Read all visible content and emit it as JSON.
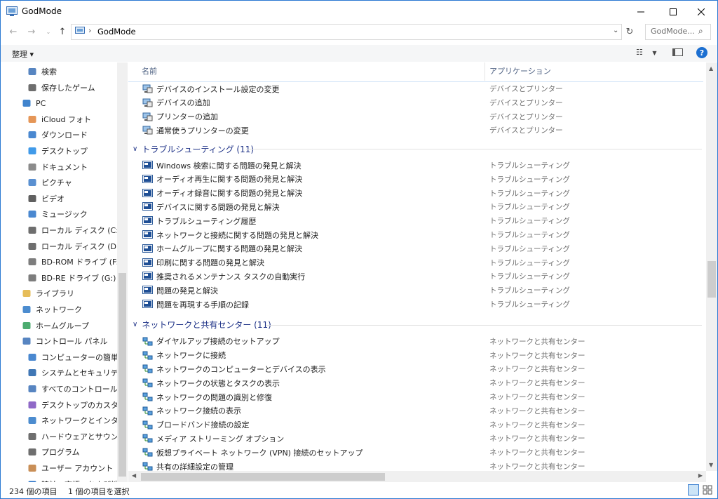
{
  "window": {
    "title": "GodMode"
  },
  "address": {
    "path": "GodMode"
  },
  "search": {
    "placeholder": "GodMode..."
  },
  "toolbar": {
    "organize_label": "整理 ▾",
    "help_label": "?"
  },
  "nav_items": [
    {
      "label": "検索",
      "icon": "magnifier-icon",
      "indent": 2
    },
    {
      "label": "保存したゲーム",
      "icon": "saved-games-icon",
      "indent": 2
    },
    {
      "label": "PC",
      "icon": "pc-icon",
      "indent": 1
    },
    {
      "label": "iCloud フォト",
      "icon": "icloud-photos-icon",
      "indent": 2
    },
    {
      "label": "ダウンロード",
      "icon": "download-icon",
      "indent": 2
    },
    {
      "label": "デスクトップ",
      "icon": "desktop-icon",
      "indent": 2
    },
    {
      "label": "ドキュメント",
      "icon": "document-icon",
      "indent": 2
    },
    {
      "label": "ピクチャ",
      "icon": "pictures-icon",
      "indent": 2
    },
    {
      "label": "ビデオ",
      "icon": "video-icon",
      "indent": 2
    },
    {
      "label": "ミュージック",
      "icon": "music-icon",
      "indent": 2
    },
    {
      "label": "ローカル ディスク (C:)",
      "icon": "drive-icon",
      "indent": 2
    },
    {
      "label": "ローカル ディスク (D:)",
      "icon": "drive-icon",
      "indent": 2
    },
    {
      "label": "BD-ROM ドライブ (F:)",
      "icon": "optical-drive-icon",
      "indent": 2
    },
    {
      "label": "BD-RE ドライブ (G:)",
      "icon": "optical-drive-icon",
      "indent": 2
    },
    {
      "label": "ライブラリ",
      "icon": "library-icon",
      "indent": 1
    },
    {
      "label": "ネットワーク",
      "icon": "network-icon",
      "indent": 1
    },
    {
      "label": "ホームグループ",
      "icon": "homegroup-icon",
      "indent": 1
    },
    {
      "label": "コントロール パネル",
      "icon": "control-panel-icon",
      "indent": 1
    },
    {
      "label": "コンピューターの簡単操作",
      "icon": "ease-of-access-icon",
      "indent": 2
    },
    {
      "label": "システムとセキュリティ",
      "icon": "shield-icon",
      "indent": 2
    },
    {
      "label": "すべてのコントロール パネ",
      "icon": "control-panel-icon",
      "indent": 2
    },
    {
      "label": "デスクトップのカスタマイズ",
      "icon": "personalize-icon",
      "indent": 2
    },
    {
      "label": "ネットワークとインターネッ",
      "icon": "network-internet-icon",
      "indent": 2
    },
    {
      "label": "ハードウェアとサウンド",
      "icon": "hardware-icon",
      "indent": 2
    },
    {
      "label": "プログラム",
      "icon": "programs-icon",
      "indent": 2
    },
    {
      "label": "ユーザー アカウント",
      "icon": "users-icon",
      "indent": 2
    },
    {
      "label": "時計、言語、および地域",
      "icon": "clock-icon",
      "indent": 2
    }
  ],
  "columns": {
    "name": "名前",
    "application": "アプリケーション"
  },
  "rows_top": [
    {
      "name": "デバイスのインストール設定の変更",
      "cat": "デバイスとプリンター"
    },
    {
      "name": "デバイスの追加",
      "cat": "デバイスとプリンター"
    },
    {
      "name": "プリンターの追加",
      "cat": "デバイスとプリンター"
    },
    {
      "name": "通常使うプリンターの変更",
      "cat": "デバイスとプリンター"
    }
  ],
  "groups": [
    {
      "title": "トラブルシューティング (11)",
      "rows": [
        {
          "name": "Windows 検索に関する問題の発見と解決",
          "cat": "トラブルシューティング"
        },
        {
          "name": "オーディオ再生に関する問題の発見と解決",
          "cat": "トラブルシューティング"
        },
        {
          "name": "オーディオ録音に関する問題の発見と解決",
          "cat": "トラブルシューティング"
        },
        {
          "name": "デバイスに関する問題の発見と解決",
          "cat": "トラブルシューティング"
        },
        {
          "name": "トラブルシューティング履歴",
          "cat": "トラブルシューティング"
        },
        {
          "name": "ネットワークと接続に関する問題の発見と解決",
          "cat": "トラブルシューティング"
        },
        {
          "name": "ホームグループに関する問題の発見と解決",
          "cat": "トラブルシューティング"
        },
        {
          "name": "印刷に関する問題の発見と解決",
          "cat": "トラブルシューティング"
        },
        {
          "name": "推奨されるメンテナンス タスクの自動実行",
          "cat": "トラブルシューティング"
        },
        {
          "name": "問題の発見と解決",
          "cat": "トラブルシューティング"
        },
        {
          "name": "問題を再現する手順の記録",
          "cat": "トラブルシューティング"
        }
      ]
    },
    {
      "title": "ネットワークと共有センター (11)",
      "rows": [
        {
          "name": "ダイヤルアップ接続のセットアップ",
          "cat": "ネットワークと共有センター"
        },
        {
          "name": "ネットワークに接続",
          "cat": "ネットワークと共有センター"
        },
        {
          "name": "ネットワークのコンピューターとデバイスの表示",
          "cat": "ネットワークと共有センター"
        },
        {
          "name": "ネットワークの状態とタスクの表示",
          "cat": "ネットワークと共有センター"
        },
        {
          "name": "ネットワークの問題の識別と修復",
          "cat": "ネットワークと共有センター"
        },
        {
          "name": "ネットワーク接続の表示",
          "cat": "ネットワークと共有センター"
        },
        {
          "name": "ブロードバンド接続の設定",
          "cat": "ネットワークと共有センター"
        },
        {
          "name": "メディア ストリーミング オプション",
          "cat": "ネットワークと共有センター"
        },
        {
          "name": "仮想プライベート ネットワーク (VPN) 接続のセットアップ",
          "cat": "ネットワークと共有センター"
        },
        {
          "name": "共有の詳細設定の管理",
          "cat": "ネットワークと共有センター"
        }
      ]
    }
  ],
  "status": {
    "count": "234 個の項目",
    "selected": "1 個の項目を選択"
  },
  "colors": {
    "accent": "#2b79d3",
    "group_title": "#1e3287"
  }
}
